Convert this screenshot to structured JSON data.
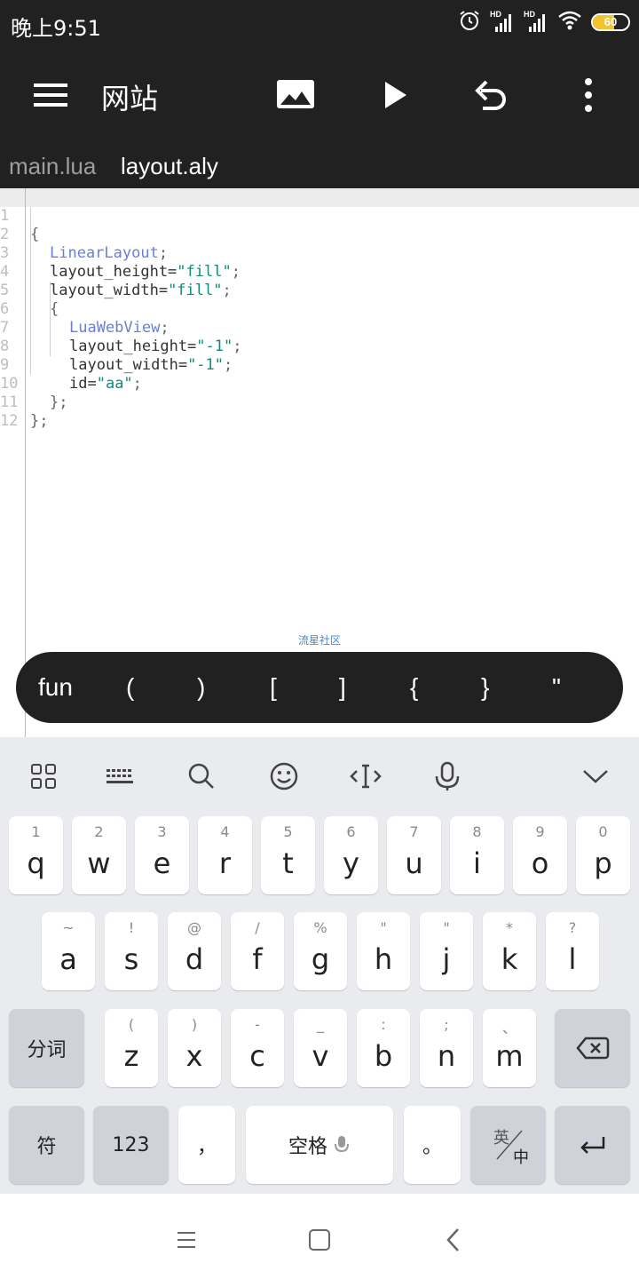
{
  "status": {
    "time": "晚上9:51",
    "battery": "60",
    "signal_label": "HD"
  },
  "toolbar": {
    "title": "网站"
  },
  "tabs": [
    {
      "label": "main.lua"
    },
    {
      "label": "layout.aly"
    }
  ],
  "editor": {
    "line_numbers": [
      "1",
      "2",
      "3",
      "4",
      "5",
      "6",
      "7",
      "8",
      "9",
      "10",
      "11",
      "12"
    ],
    "code": {
      "l1": "{",
      "l2_kw": "LinearLayout",
      "l2_p": ";",
      "l3_a": "layout_height=",
      "l3_s": "\"fill\"",
      "l3_p": ";",
      "l4_a": "layout_width=",
      "l4_s": "\"fill\"",
      "l4_p": ";",
      "l5": "{",
      "l6_kw": "LuaWebView",
      "l6_p": ";",
      "l7_a": "layout_height=",
      "l7_s": "\"-1\"",
      "l7_p": ";",
      "l8_a": "layout_width=",
      "l8_s": "\"-1\"",
      "l8_p": ";",
      "l9_a": "id=",
      "l9_s": "\"aa\"",
      "l9_p": ";",
      "l10": "};",
      "l11": "};"
    },
    "watermark": "流星社区"
  },
  "symbol_bar": [
    "fun",
    "(",
    ")",
    "[",
    "]",
    "{",
    "}",
    "\""
  ],
  "keyboard": {
    "row1": [
      {
        "hint": "1",
        "key": "q"
      },
      {
        "hint": "2",
        "key": "w"
      },
      {
        "hint": "3",
        "key": "e"
      },
      {
        "hint": "4",
        "key": "r"
      },
      {
        "hint": "5",
        "key": "t"
      },
      {
        "hint": "6",
        "key": "y"
      },
      {
        "hint": "7",
        "key": "u"
      },
      {
        "hint": "8",
        "key": "i"
      },
      {
        "hint": "9",
        "key": "o"
      },
      {
        "hint": "0",
        "key": "p"
      }
    ],
    "row2": [
      {
        "hint": "~",
        "key": "a"
      },
      {
        "hint": "!",
        "key": "s"
      },
      {
        "hint": "@",
        "key": "d"
      },
      {
        "hint": "/",
        "key": "f"
      },
      {
        "hint": "%",
        "key": "g"
      },
      {
        "hint": "\"",
        "key": "h"
      },
      {
        "hint": "\"",
        "key": "j"
      },
      {
        "hint": "*",
        "key": "k"
      },
      {
        "hint": "?",
        "key": "l"
      }
    ],
    "row3": [
      {
        "hint": "(",
        "key": "z"
      },
      {
        "hint": ")",
        "key": "x"
      },
      {
        "hint": "-",
        "key": "c"
      },
      {
        "hint": "_",
        "key": "v"
      },
      {
        "hint": ":",
        "key": "b"
      },
      {
        "hint": ";",
        "key": "n"
      },
      {
        "hint": "、",
        "key": "m"
      }
    ],
    "fenci": "分词",
    "fu": "符",
    "num": "123",
    "comma": "，",
    "space": "空格",
    "period": "。",
    "lang_top": "英",
    "lang_bottom": "中"
  }
}
